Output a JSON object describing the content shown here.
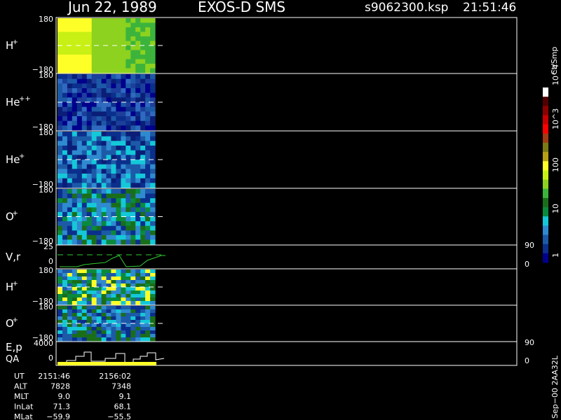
{
  "header": {
    "date": "Jun 22, 1989",
    "instrument": "EXOS-D SMS",
    "file": "s9062300.ksp",
    "time": "21:51:46"
  },
  "colorbar": {
    "unit": "Ct/Smp",
    "ticks": [
      "1",
      "10",
      "100",
      "10^3",
      "10^4"
    ],
    "colors": [
      "#00008c",
      "#0b2f8c",
      "#1c5aa8",
      "#2f8ad0",
      "#14c8d8",
      "#0a8a3c",
      "#1a6e1a",
      "#3cb43c",
      "#8cd21e",
      "#c8f014",
      "#ffff28",
      "#b4a014",
      "#7a7a14",
      "#a03c14",
      "#ff0000",
      "#c80000",
      "#8c0000",
      "#500000",
      "#ffffff"
    ]
  },
  "panels": [
    {
      "label": "H",
      "sup": "+",
      "ymax": "180",
      "ymin": "−180"
    },
    {
      "label": "He",
      "sup": "++",
      "ymax": "180",
      "ymin": "−180"
    },
    {
      "label": "He",
      "sup": "+",
      "ymax": "180",
      "ymin": "−180"
    },
    {
      "label": "O",
      "sup": "+",
      "ymax": "180",
      "ymin": "−180"
    },
    {
      "label": "V,r",
      "sup": "",
      "ymax": "25",
      "ymin": "0",
      "rmax": "90",
      "rmin": "0"
    },
    {
      "label": "H",
      "sup": "+",
      "ymax": "180",
      "ymin": "−180"
    },
    {
      "label": "O",
      "sup": "+",
      "ymax": "180",
      "ymin": "−180"
    },
    {
      "label": "E,p",
      "label2": "QA",
      "sup": "",
      "ymax": "4000",
      "ymin": "0",
      "rmax": "90",
      "rmin": "0"
    }
  ],
  "orbit_table": {
    "rows": [
      {
        "name": "UT",
        "v1": "2151:46",
        "v2": "2156:02"
      },
      {
        "name": "ALT",
        "v1": "7828",
        "v2": "7348"
      },
      {
        "name": "MLT",
        "v1": "9.0",
        "v2": "9.1"
      },
      {
        "name": "InLat",
        "v1": "71.3",
        "v2": "68.1"
      },
      {
        "name": "MLat",
        "v1": "−59.9",
        "v2": "−55.5"
      }
    ]
  },
  "footer_right": "Sep−00 2AA32L",
  "chart_data": {
    "type": "heatmap",
    "x": [
      "2151:46",
      "2156:02"
    ],
    "panels": [
      {
        "species": "H+",
        "ylim": [
          -180,
          180
        ],
        "dominant_level": "100"
      },
      {
        "species": "He++",
        "ylim": [
          -180,
          180
        ],
        "dominant_level": "1"
      },
      {
        "species": "He+",
        "ylim": [
          -180,
          180
        ],
        "dominant_level": "1-10"
      },
      {
        "species": "O+",
        "ylim": [
          -180,
          180
        ],
        "dominant_level": "10"
      },
      {
        "species": "V,r",
        "ylim": [
          0,
          25
        ],
        "rlim": [
          0,
          90
        ]
      },
      {
        "species": "H+",
        "ylim": [
          -180,
          180
        ]
      },
      {
        "species": "O+",
        "ylim": [
          -180,
          180
        ]
      },
      {
        "species": "E,p / QA",
        "ylim": [
          0,
          4000
        ],
        "rlim": [
          0,
          90
        ]
      }
    ]
  }
}
